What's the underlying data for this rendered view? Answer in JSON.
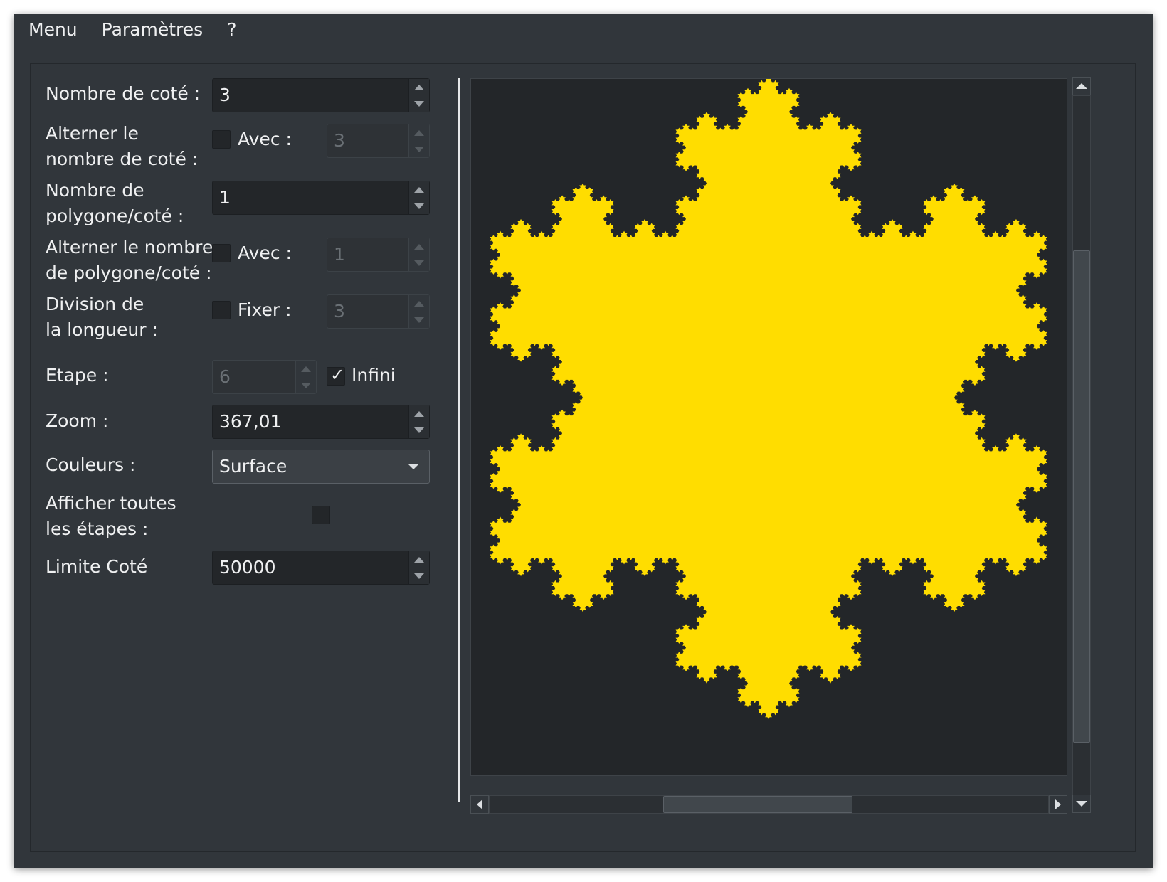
{
  "menubar": {
    "items": [
      "Menu",
      "Paramètres",
      "?"
    ]
  },
  "form": {
    "sides_label": "Nombre de coté :",
    "sides_value": "3",
    "alt_sides_label": "Alterner le\nnombre de coté :",
    "alt_sides_with": "Avec :",
    "alt_sides_value": "3",
    "polygons_label": "Nombre de\npolygone/coté :",
    "polygons_value": "1",
    "alt_polygons_label": "Alterner le nombre\nde polygone/coté :",
    "alt_polygons_with": "Avec :",
    "alt_polygons_value": "1",
    "division_label": "Division de\nla longueur :",
    "division_fix": "Fixer :",
    "division_value": "3",
    "step_label": "Etape :",
    "step_value": "6",
    "infinite_label": "Infini",
    "infinite_checked": true,
    "zoom_label": "Zoom :",
    "zoom_value": "367,01",
    "colors_label": "Couleurs :",
    "colors_value": "Surface",
    "show_all_label": "Afficher toutes\nles étapes :",
    "limit_label": "Limite Coté",
    "limit_value": "50000"
  },
  "canvas": {
    "fractal": "koch-snowflake",
    "fill_color": "#ffdd00",
    "background_color": "#232629"
  }
}
